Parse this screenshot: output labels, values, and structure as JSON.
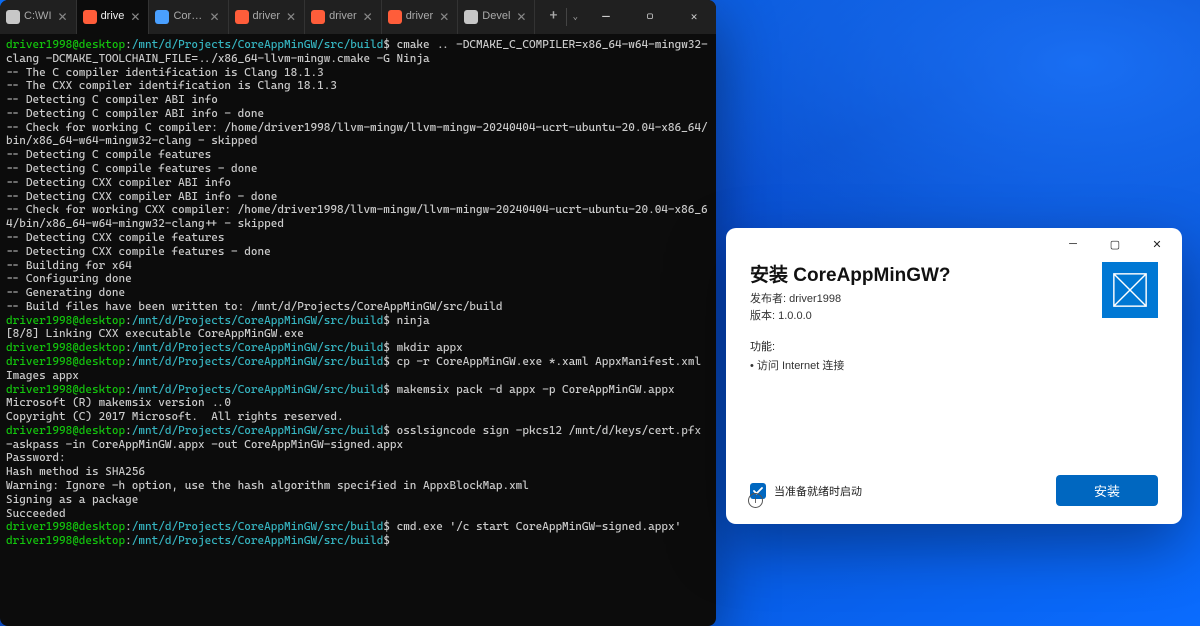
{
  "terminal": {
    "tabs": [
      {
        "icon": "#c7c7c7",
        "label": "C:\\WI",
        "active": false
      },
      {
        "icon": "#ff5d3a",
        "label": "drive",
        "active": true
      },
      {
        "icon": "#4aa0ff",
        "label": "CoreA",
        "active": false
      },
      {
        "icon": "#ff5d3a",
        "label": "driver",
        "active": false
      },
      {
        "icon": "#ff5d3a",
        "label": "driver",
        "active": false
      },
      {
        "icon": "#ff5d3a",
        "label": "driver",
        "active": false
      },
      {
        "icon": "#c7c7c7",
        "label": "Devel",
        "active": false
      }
    ],
    "prompt": {
      "user": "driver1998@desktop",
      "colon": ":",
      "path": "/mnt/d/Projects/CoreAppMinGW/src/build",
      "dollar": "$ "
    },
    "cmds": {
      "cmake": "cmake .. -DCMAKE_C_COMPILER=x86_64-w64-mingw32-clang -DCMAKE_TOOLCHAIN_FILE=../x86_64-llvm-mingw.cmake -G Ninja",
      "ninja": "ninja",
      "mkdir": "mkdir appx",
      "cp": "cp -r CoreAppMinGW.exe *.xaml AppxManifest.xml Images appx",
      "makemsix": "makemsix pack -d appx -p CoreAppMinGW.appx",
      "sign": "osslsigncode sign -pkcs12 /mnt/d/keys/cert.pfx -askpass -in CoreAppMinGW.appx -out CoreAppMinGW-signed.appx",
      "start": "cmd.exe '/c start CoreAppMinGW-signed.appx'"
    },
    "out": {
      "l1": "-- The C compiler identification is Clang 18.1.3",
      "l2": "-- The CXX compiler identification is Clang 18.1.3",
      "l3": "-- Detecting C compiler ABI info",
      "l4": "-- Detecting C compiler ABI info - done",
      "l5": "-- Check for working C compiler: /home/driver1998/llvm-mingw/llvm-mingw-20240404-ucrt-ubuntu-20.04-x86_64/bin/x86_64-w64-mingw32-clang - skipped",
      "l6": "-- Detecting C compile features",
      "l7": "-- Detecting C compile features - done",
      "l8": "-- Detecting CXX compiler ABI info",
      "l9": "-- Detecting CXX compiler ABI info - done",
      "l10": "-- Check for working CXX compiler: /home/driver1998/llvm-mingw/llvm-mingw-20240404-ucrt-ubuntu-20.04-x86_64/bin/x86_64-w64-mingw32-clang++ - skipped",
      "l11": "-- Detecting CXX compile features",
      "l12": "-- Detecting CXX compile features - done",
      "l13": "-- Building for x64",
      "l14": "-- Configuring done",
      "l15": "-- Generating done",
      "l16": "-- Build files have been written to: /mnt/d/Projects/CoreAppMinGW/src/build",
      "ninja1": "[8/8] Linking CXX executable CoreAppMinGW.exe",
      "mm1": "Microsoft (R) makemsix version ..0",
      "mm2": "Copyright (C) 2017 Microsoft.  All rights reserved.",
      "s1": "Password:",
      "s2": "Hash method is SHA256",
      "s3": "Warning: Ignore -h option, use the hash algorithm specified in AppxBlockMap.xml",
      "s4": "Signing as a package",
      "s5": "Succeeded"
    }
  },
  "dialog": {
    "title": "安装 CoreAppMinGW?",
    "publisher_label": "发布者: ",
    "publisher": "driver1998",
    "version_label": "版本: ",
    "version": "1.0.0.0",
    "capabilities_header": "功能:",
    "cap1": "• 访问 Internet 连接",
    "checkbox_label": "当准备就绪时启动",
    "install_button": "安装"
  }
}
